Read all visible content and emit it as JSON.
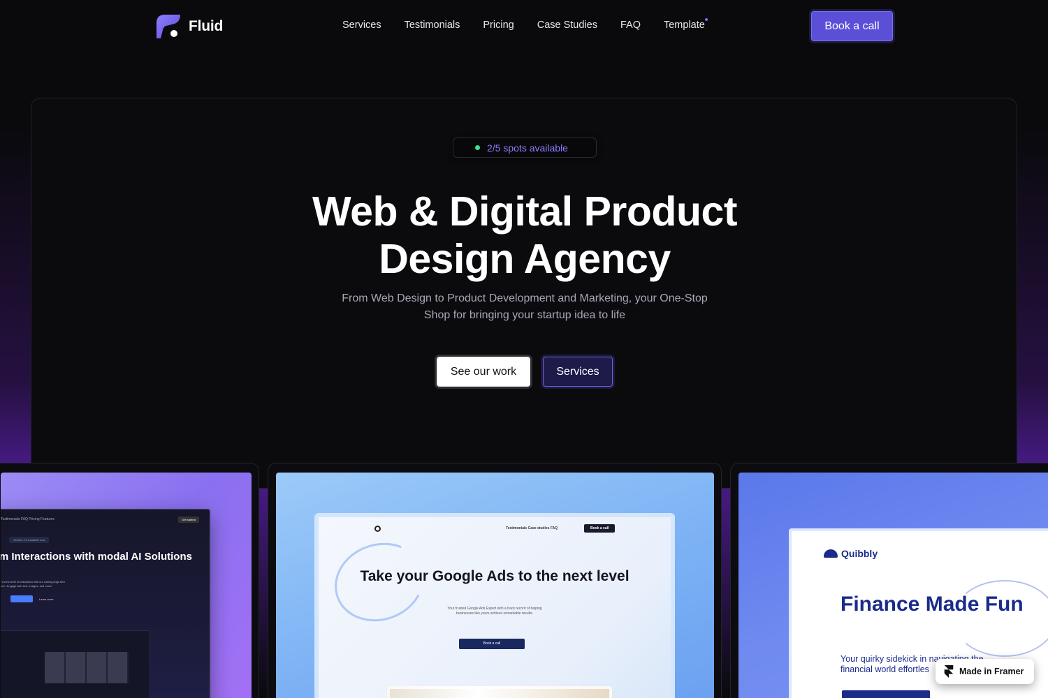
{
  "brand": {
    "name": "Fluid"
  },
  "nav": {
    "links": [
      "Services",
      "Testimonials",
      "Pricing",
      "Case Studies",
      "FAQ",
      "Template"
    ],
    "cta": "Book a call"
  },
  "hero": {
    "badge": "2/5 spots available",
    "title_line1": "Web & Digital Product",
    "title_line2": "Design Agency",
    "subtitle": "From Web Design to Product Development and Marketing, your One-Stop Shop for bringing your startup idea to life",
    "primary_button": "See our work",
    "secondary_button": "Services"
  },
  "showcase": [
    {
      "nav_items": "Testimonials   FAQ   Pricing   Features",
      "cta": "Get started",
      "pill": "Version 2.0 available now",
      "title": "rm Interactions with modal AI Solutions",
      "description": "ence a new level of interaction with our cutting-edge ited platform. Engage with text, images, and more!",
      "secondary": "Learn more"
    },
    {
      "nav_items": "Testimonials   Case studies   FAQ",
      "cta": "Book a call",
      "title": "Take your Google Ads to the next level",
      "description": "Your trusted Google Ads Expert with a track record of helping businesses like yours achieve remarkable results.",
      "button": "Book a call"
    },
    {
      "brand": "Quibbly",
      "title": "Finance Made Fun",
      "description": "Your quirky sidekick in navigating the financial world effortles"
    }
  ],
  "framer_badge": "Made in Framer",
  "colors": {
    "background": "#0a0a0c",
    "accent": "#5b4fd8",
    "badge_text": "#8b7dff",
    "status_dot": "#3ee08f"
  }
}
